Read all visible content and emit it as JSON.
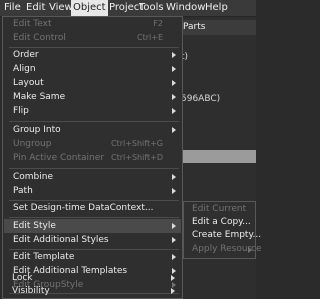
{
  "menubar": {
    "items": [
      {
        "label": "File",
        "active": false
      },
      {
        "label": "Edit",
        "active": false
      },
      {
        "label": "View",
        "active": false
      },
      {
        "label": "Object",
        "active": true
      },
      {
        "label": "Project",
        "active": false
      },
      {
        "label": "Tools",
        "active": false
      },
      {
        "label": "Window",
        "active": false
      },
      {
        "label": "Help",
        "active": false
      }
    ]
  },
  "background": {
    "tab_label": "Parts",
    "fragment_1": "t)",
    "fragment_2": "596ABC)"
  },
  "object_menu": {
    "items": [
      {
        "label": "Edit Text",
        "shortcut": "F2",
        "disabled": true,
        "submenu": false,
        "highlighted": false
      },
      {
        "label": "Edit Control",
        "shortcut": "Ctrl+E",
        "disabled": true,
        "submenu": false,
        "highlighted": false
      },
      {
        "label": "Order",
        "shortcut": "",
        "disabled": false,
        "submenu": true,
        "highlighted": false
      },
      {
        "label": "Align",
        "shortcut": "",
        "disabled": false,
        "submenu": true,
        "highlighted": false
      },
      {
        "label": "Layout",
        "shortcut": "",
        "disabled": false,
        "submenu": true,
        "highlighted": false
      },
      {
        "label": "Make Same",
        "shortcut": "",
        "disabled": false,
        "submenu": true,
        "highlighted": false
      },
      {
        "label": "Flip",
        "shortcut": "",
        "disabled": false,
        "submenu": true,
        "highlighted": false
      },
      {
        "label": "Group Into",
        "shortcut": "",
        "disabled": false,
        "submenu": true,
        "highlighted": false
      },
      {
        "label": "Ungroup",
        "shortcut": "Ctrl+Shift+G",
        "disabled": true,
        "submenu": false,
        "highlighted": false
      },
      {
        "label": "Pin Active Container",
        "shortcut": "Ctrl+Shift+D",
        "disabled": true,
        "submenu": false,
        "highlighted": false
      },
      {
        "label": "Combine",
        "shortcut": "",
        "disabled": false,
        "submenu": true,
        "highlighted": false
      },
      {
        "label": "Path",
        "shortcut": "",
        "disabled": false,
        "submenu": true,
        "highlighted": false
      },
      {
        "label": "Set Design-time DataContext...",
        "shortcut": "",
        "disabled": false,
        "submenu": false,
        "highlighted": false
      },
      {
        "label": "Edit Style",
        "shortcut": "",
        "disabled": false,
        "submenu": true,
        "highlighted": true
      },
      {
        "label": "Edit Additional Styles",
        "shortcut": "",
        "disabled": false,
        "submenu": true,
        "highlighted": false
      },
      {
        "label": "Edit Template",
        "shortcut": "",
        "disabled": false,
        "submenu": true,
        "highlighted": false
      },
      {
        "label": "Edit Additional Templates",
        "shortcut": "",
        "disabled": false,
        "submenu": true,
        "highlighted": false
      },
      {
        "label": "Edit GroupStyle",
        "shortcut": "",
        "disabled": true,
        "submenu": true,
        "highlighted": false
      },
      {
        "label": "Lock",
        "shortcut": "",
        "disabled": false,
        "submenu": true,
        "highlighted": false
      },
      {
        "label": "Visibility",
        "shortcut": "",
        "disabled": false,
        "submenu": true,
        "highlighted": false
      }
    ]
  },
  "edit_style_submenu": {
    "items": [
      {
        "label": "Edit Current",
        "disabled": true,
        "submenu": false
      },
      {
        "label": "Edit a Copy...",
        "disabled": false,
        "submenu": false
      },
      {
        "label": "Create Empty...",
        "disabled": false,
        "submenu": false
      },
      {
        "label": "Apply Resource",
        "disabled": true,
        "submenu": true
      }
    ]
  }
}
